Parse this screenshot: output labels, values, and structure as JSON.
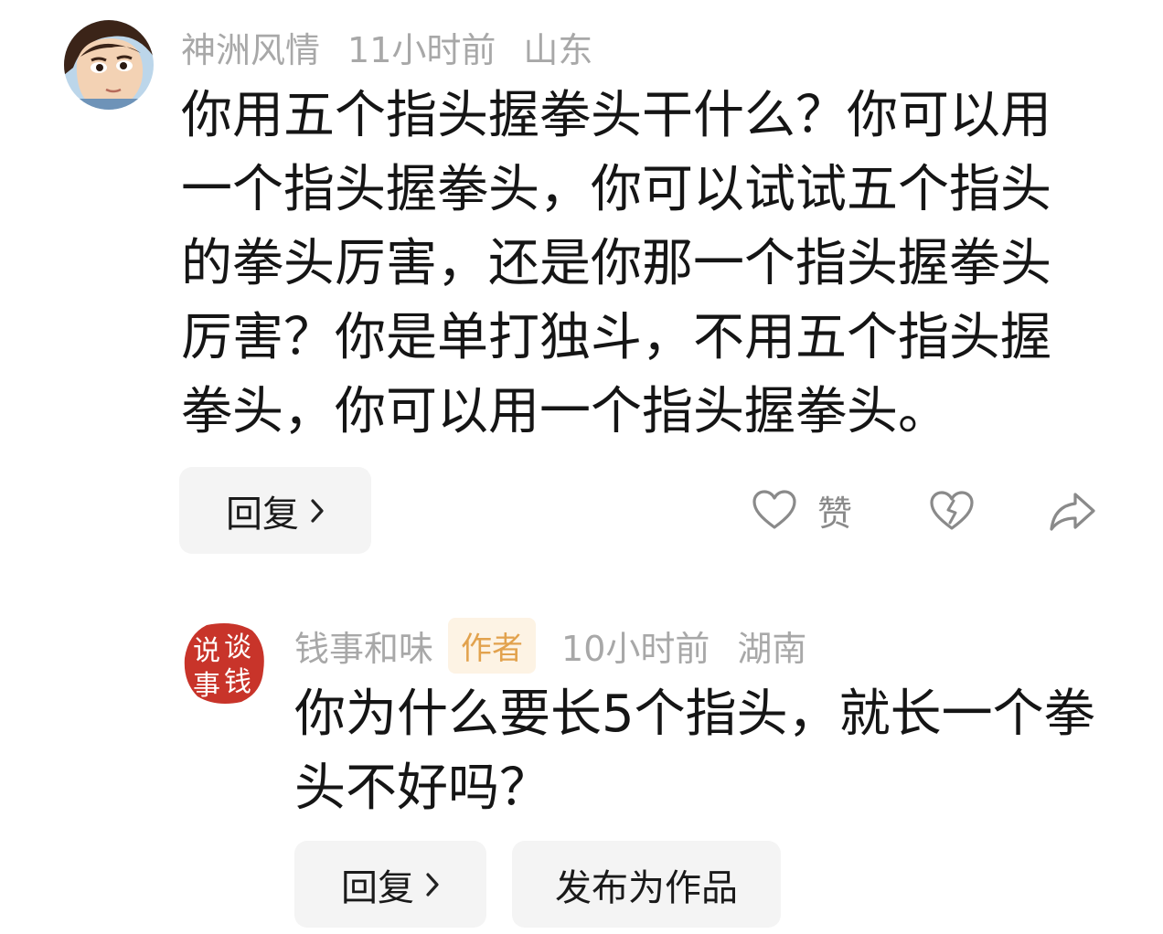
{
  "comments": [
    {
      "username": "神洲风情",
      "time": "11小时前",
      "location": "山东",
      "lines": [
        "你用五个指头握拳头干什么？你可以用",
        "一个指头握拳头，你可以试试五个指头",
        "的拳头厉害，还是你那一个指头握拳头",
        "厉害？你是单打独斗，不用五个指头握",
        "拳头，你可以用一个指头握拳头。"
      ],
      "reply_label": "回复",
      "like_label": "赞"
    },
    {
      "username": "钱事和味",
      "badge": "作者",
      "time": "10小时前",
      "location": "湖南",
      "avatar_text": [
        "谈",
        "说",
        "钱",
        "事"
      ],
      "lines": [
        "你为什么要长5个指头，就长一个拳",
        "头不好吗？"
      ],
      "reply_label": "回复",
      "publish_label": "发布为作品"
    }
  ],
  "icons": {
    "like": "heart-outline-icon",
    "dislike": "broken-heart-icon",
    "share": "share-arrow-icon",
    "chevron": "chevron-right-icon"
  },
  "colors": {
    "meta_text": "#a8a8a8",
    "badge_text": "#e2a24d",
    "badge_bg": "#fdf3e4",
    "chip_bg": "#f4f4f4",
    "seal_red": "#c8342a"
  }
}
